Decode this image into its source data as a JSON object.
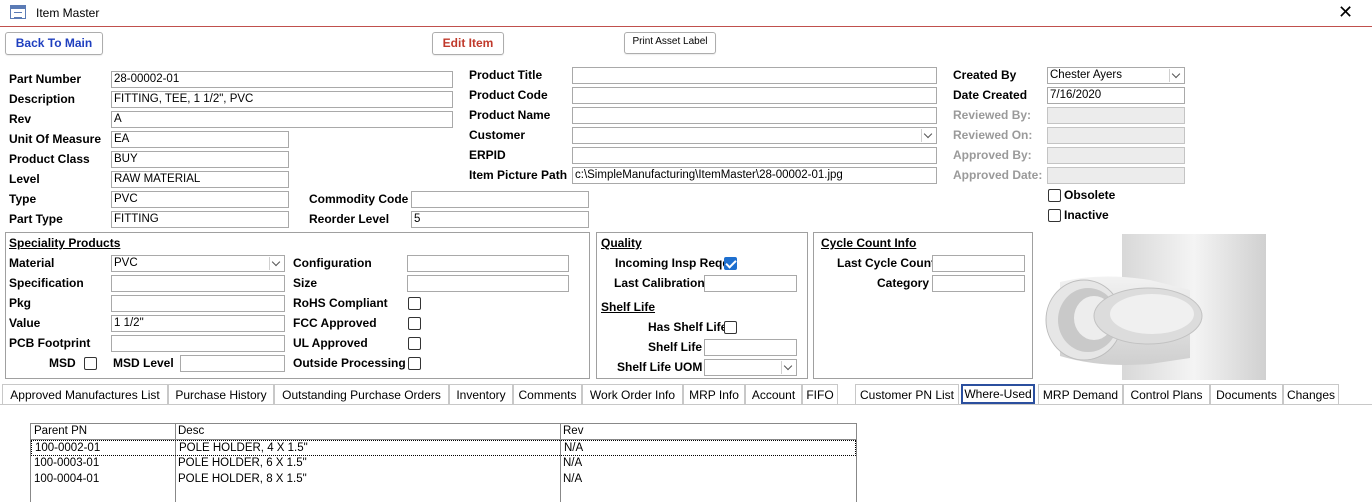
{
  "window": {
    "title": "Item Master",
    "close_glyph": "✕"
  },
  "buttons": {
    "back_to_main": "Back To Main",
    "edit_item": "Edit Item",
    "print_asset_label": "Print Asset Label"
  },
  "left": {
    "part_number": {
      "label": "Part Number",
      "value": "28-00002-01"
    },
    "description": {
      "label": "Description",
      "value": "FITTING, TEE, 1 1/2\", PVC"
    },
    "rev": {
      "label": "Rev",
      "value": "A"
    },
    "unit_of_measure": {
      "label": "Unit Of Measure",
      "value": "EA"
    },
    "product_class": {
      "label": "Product Class",
      "value": "BUY"
    },
    "level": {
      "label": "Level",
      "value": "RAW MATERIAL"
    },
    "type": {
      "label": "Type",
      "value": "PVC"
    },
    "part_type": {
      "label": "Part Type",
      "value": "FITTING"
    },
    "commodity_code": {
      "label": "Commodity Code",
      "value": ""
    },
    "reorder_level": {
      "label": "Reorder Level",
      "value": "5"
    }
  },
  "middle": {
    "product_title": {
      "label": "Product Title",
      "value": ""
    },
    "product_code": {
      "label": "Product Code",
      "value": ""
    },
    "product_name": {
      "label": "Product Name",
      "value": ""
    },
    "customer": {
      "label": "Customer",
      "value": ""
    },
    "erpid": {
      "label": "ERPID",
      "value": ""
    },
    "item_picture_path": {
      "label": "Item Picture Path",
      "value": "c:\\SimpleManufacturing\\ItemMaster\\28-00002-01.jpg"
    }
  },
  "right": {
    "created_by": {
      "label": "Created By",
      "value": "Chester Ayers"
    },
    "date_created": {
      "label": "Date Created",
      "value": "7/16/2020"
    },
    "reviewed_by": {
      "label": "Reviewed By:",
      "value": ""
    },
    "reviewed_on": {
      "label": "Reviewed On:",
      "value": ""
    },
    "approved_by": {
      "label": "Approved By:",
      "value": ""
    },
    "approved_date": {
      "label": "Approved Date:",
      "value": ""
    },
    "obsolete": {
      "label": "Obsolete",
      "checked": false
    },
    "inactive": {
      "label": "Inactive",
      "checked": false
    }
  },
  "speciality": {
    "title": "Speciality Products",
    "material": {
      "label": "Material",
      "value": "PVC"
    },
    "specification": {
      "label": "Specification",
      "value": ""
    },
    "pkg": {
      "label": "Pkg",
      "value": ""
    },
    "value": {
      "label": "Value",
      "value": "1 1/2\""
    },
    "pcb_footprint": {
      "label": "PCB Footprint",
      "value": ""
    },
    "msd": {
      "label": "MSD",
      "checked": false
    },
    "msd_level": {
      "label": "MSD Level",
      "value": ""
    },
    "configuration": {
      "label": "Configuration",
      "value": ""
    },
    "size": {
      "label": "Size",
      "value": ""
    },
    "rohs_compliant": {
      "label": "RoHS Compliant",
      "checked": false
    },
    "fcc_approved": {
      "label": "FCC Approved",
      "checked": false
    },
    "ul_approved": {
      "label": "UL Approved",
      "checked": false
    },
    "outside_processing": {
      "label": "Outside Processing",
      "checked": false
    }
  },
  "quality": {
    "title": "Quality",
    "incoming_insp_reqd": {
      "label": "Incoming Insp Reqd",
      "checked": true
    },
    "last_calibration": {
      "label": "Last Calibration",
      "value": ""
    },
    "shelf_life_title": "Shelf Life",
    "has_shelf_life": {
      "label": "Has Shelf Life",
      "checked": false
    },
    "shelf_life": {
      "label": "Shelf Life",
      "value": ""
    },
    "shelf_life_uom": {
      "label": "Shelf Life UOM",
      "value": ""
    }
  },
  "cycle_count": {
    "title": "Cycle Count Info",
    "last_cycle_count": {
      "label": "Last Cycle Count",
      "value": ""
    },
    "category": {
      "label": "Category",
      "value": ""
    }
  },
  "tabs": [
    "Approved Manufactures List",
    "Purchase History",
    "Outstanding Purchase Orders",
    "Inventory",
    "Comments",
    "Work Order Info",
    "MRP Info",
    "Account",
    "FIFO",
    "Customer PN List",
    "Where-Used",
    "MRP Demand",
    "Control Plans",
    "Documents",
    "Changes"
  ],
  "active_tab": "Where-Used",
  "where_used": {
    "columns": [
      "Parent PN",
      "Desc",
      "Rev"
    ],
    "rows": [
      [
        "100-0002-01",
        "POLE HOLDER, 4 X 1.5\"",
        "N/A"
      ],
      [
        "100-0003-01",
        "POLE HOLDER, 6 X 1.5\"",
        "N/A"
      ],
      [
        "100-0004-01",
        "POLE HOLDER, 8 X 1.5\"",
        "N/A"
      ]
    ]
  },
  "picture": {
    "icon": "pvc-tee-fitting-image"
  }
}
